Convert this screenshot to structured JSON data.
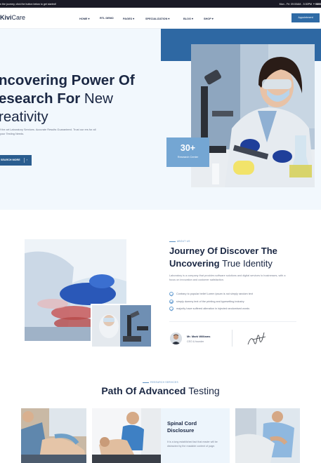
{
  "topbar": {
    "message": "n the journey, click the button below to get started!",
    "hours": "Mon - Fri: 09:00AM - 5:30PM",
    "extra": "+ 0800"
  },
  "header": {
    "logo_bold": "Kivi",
    "logo_light": "Care",
    "menu": [
      "HOME ▾",
      "RTL DEMO",
      "PAGES ▾",
      "SPECIALIZATION ▾",
      "BLOG ▾",
      "SHOP ▾"
    ],
    "appointment_label": "Appointment"
  },
  "hero": {
    "title_line1": "ncovering Power Of",
    "title_line2_bold": "esearch For ",
    "title_line2_light": "New",
    "title_line3": "reativity",
    "description": "f the art Laboratory Services. Accurate Results Guaranteed. Trust our ers for all your Testing Needs.",
    "button_label": "SEARCH MORE",
    "button_arrow": "›",
    "stat_number": "30+",
    "stat_label": "Research Center"
  },
  "about": {
    "eyebrow": "ABOUT US",
    "title_line1": "Journey Of Discover The",
    "title_line2_bold": "Uncovering ",
    "title_line2_light": "True Identity",
    "description": "Laboratory is a company that provides software solutions and digital services to businesses, with a focus on innovation and customer satisfaction.",
    "checklist": [
      "Contrary to popular belief Lorem Ipsum is not simply random text",
      "simply dummy text of the printing and typesetting industry",
      "majority have suffered alteration in injected randomised words"
    ],
    "author_name": "Mr. Mark Williams",
    "author_role": "CEO & founder"
  },
  "services": {
    "eyebrow": "RESEARCH SERVICES",
    "title_bold": "Path Of Advanced ",
    "title_light": "Testing",
    "featured_title_line1": "Spinal Cord",
    "featured_title_line2": "Disclosure",
    "featured_desc": "It is a long established fact that reader will be distracted by the readable content of page."
  },
  "colors": {
    "primary": "#2f6ba6",
    "dark_navy": "#1a2743",
    "hero_bg": "#f2f8fd",
    "stat_box": "#74a6d3",
    "topbar": "#1a1a26"
  }
}
